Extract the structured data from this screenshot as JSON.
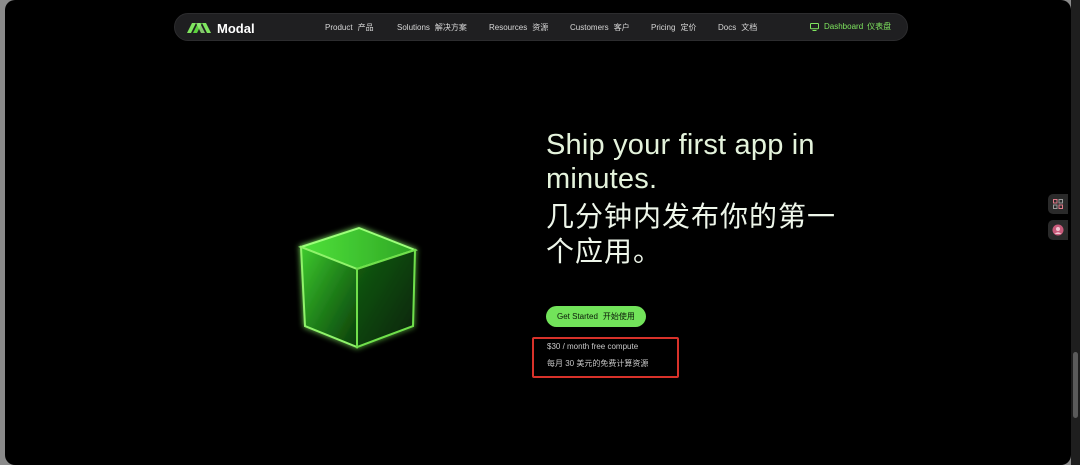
{
  "brand": {
    "name": "Modal",
    "accent_color": "#72e35a"
  },
  "nav": {
    "items": [
      {
        "en": "Product",
        "zh": "产品"
      },
      {
        "en": "Solutions",
        "zh": "解决方案"
      },
      {
        "en": "Resources",
        "zh": "资源"
      },
      {
        "en": "Customers",
        "zh": "客户"
      },
      {
        "en": "Pricing",
        "zh": "定价"
      },
      {
        "en": "Docs",
        "zh": "文档"
      }
    ],
    "dashboard": {
      "en": "Dashboard",
      "zh": "仪表盘",
      "icon": "monitor-icon"
    }
  },
  "hero": {
    "headline_en": "Ship your first app in minutes.",
    "headline_zh": "几分钟内发布你的第一个应用。",
    "cta": {
      "en": "Get Started",
      "zh": "开始使用"
    },
    "free_tier_en": "$30 / month free compute",
    "free_tier_zh": "每月 30 美元的免费计算资源",
    "highlight_color": "#d8322a"
  }
}
